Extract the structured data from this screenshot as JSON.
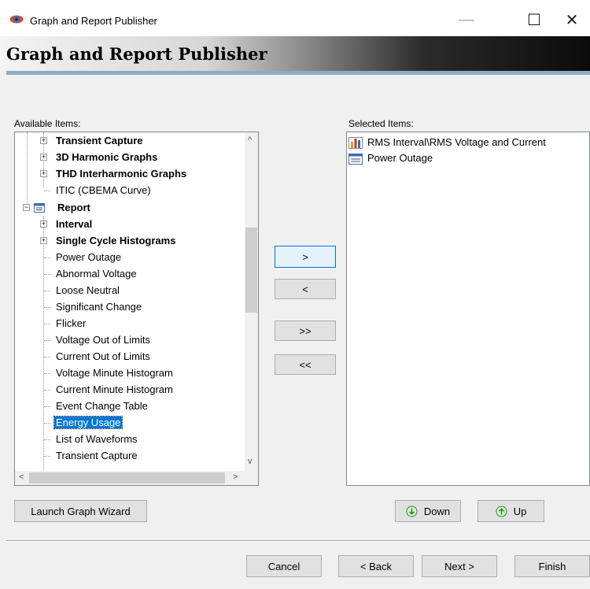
{
  "window": {
    "title": "Graph and Report Publisher",
    "minimize": "—",
    "maximize": "☐",
    "close": "✕"
  },
  "header": {
    "title": "Graph and Report Publisher"
  },
  "available": {
    "label": "Available Items:",
    "items": [
      {
        "label": "Transient Capture",
        "bold": true
      },
      {
        "label": "3D Harmonic Graphs",
        "bold": true
      },
      {
        "label": "THD Interharmonic Graphs",
        "bold": true
      },
      {
        "label": "ITIC (CBEMA Curve)",
        "bold": false
      },
      {
        "label": "Report",
        "bold": true
      },
      {
        "label": "Interval",
        "bold": true
      },
      {
        "label": "Single Cycle Histograms",
        "bold": true
      },
      {
        "label": "Power Outage",
        "bold": false
      },
      {
        "label": "Abnormal Voltage",
        "bold": false
      },
      {
        "label": "Loose Neutral",
        "bold": false
      },
      {
        "label": "Significant Change",
        "bold": false
      },
      {
        "label": "Flicker",
        "bold": false
      },
      {
        "label": "Voltage Out of Limits",
        "bold": false
      },
      {
        "label": "Current Out of Limits",
        "bold": false
      },
      {
        "label": "Voltage Minute Histogram",
        "bold": false
      },
      {
        "label": "Current Minute Histogram",
        "bold": false
      },
      {
        "label": "Event Change Table",
        "bold": false
      },
      {
        "label": "Energy Usage",
        "bold": false,
        "selected": true
      },
      {
        "label": "List of Waveforms",
        "bold": false
      },
      {
        "label": "Transient Capture",
        "bold": false
      }
    ]
  },
  "selected": {
    "label": "Selected Items:",
    "items": [
      {
        "label": "RMS Interval\\RMS Voltage and Current",
        "icon": "bar-chart-icon"
      },
      {
        "label": "Power Outage",
        "icon": "report-icon"
      }
    ]
  },
  "transfer": {
    "add": ">",
    "remove": "<",
    "add_all": ">>",
    "remove_all": "<<"
  },
  "buttons": {
    "launch_wizard": "Launch Graph Wizard",
    "down": "Down",
    "up": "Up",
    "cancel": "Cancel",
    "back": "< Back",
    "next": "Next >",
    "finish": "Finish"
  },
  "colors": {
    "selection": "#0078d7",
    "header_rule": "#8fa9c9",
    "button_face": "#e1e1e1"
  }
}
